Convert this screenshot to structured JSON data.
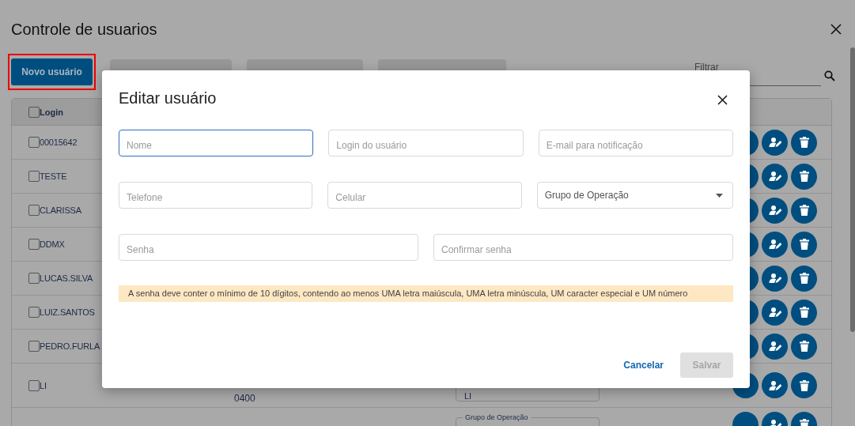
{
  "page": {
    "title": "Controle de usuarios"
  },
  "toolbar": {
    "new_user_button": "Novo usuário",
    "highlighted": true,
    "filter": {
      "placeholder": "Filtrar"
    }
  },
  "table": {
    "columns": [
      "Login"
    ],
    "header_checked": false,
    "rows": [
      {
        "login": "00015642",
        "checked": false
      },
      {
        "login": "TESTE",
        "checked": false
      },
      {
        "login": "CLARISSA",
        "checked": false
      },
      {
        "login": "DDMX",
        "checked": false
      },
      {
        "login": "LUCAS.SILVA",
        "checked": false
      },
      {
        "login": "LUIZ.SANTOS",
        "checked": false
      },
      {
        "login": "PEDRO.FURLA",
        "checked": false
      },
      {
        "login": "LI",
        "checked": false,
        "phone_line_2": "0400",
        "field_value": "LI"
      },
      {
        "field_label": "Grupo de Operação"
      }
    ]
  },
  "modal": {
    "title": "Editar usuário",
    "field_rows": [
      [
        {
          "kind": "text",
          "placeholder": "Nome",
          "focused": true
        },
        {
          "kind": "text",
          "placeholder": "Login do usuário",
          "focused": false
        },
        {
          "kind": "text",
          "placeholder": "E-mail para notificação",
          "focused": false
        }
      ],
      [
        {
          "kind": "text",
          "placeholder": "Telefone",
          "focused": false
        },
        {
          "kind": "text",
          "placeholder": "Celular",
          "focused": false
        },
        {
          "kind": "select",
          "label": "Grupo de Operação",
          "focused": false
        }
      ],
      [
        {
          "kind": "password",
          "placeholder": "Senha",
          "focused": false
        },
        {
          "kind": "password",
          "placeholder": "Confirmar senha",
          "focused": false
        }
      ]
    ],
    "notice": "A senha deve conter o mínimo de 10 dígitos, contendo ao menos UMA letra maiúscula, UMA letra minúscula, UM caracter especial e UM número",
    "cancel_button": "Cancelar",
    "save_button": {
      "label": "Salvar",
      "disabled": true
    }
  }
}
